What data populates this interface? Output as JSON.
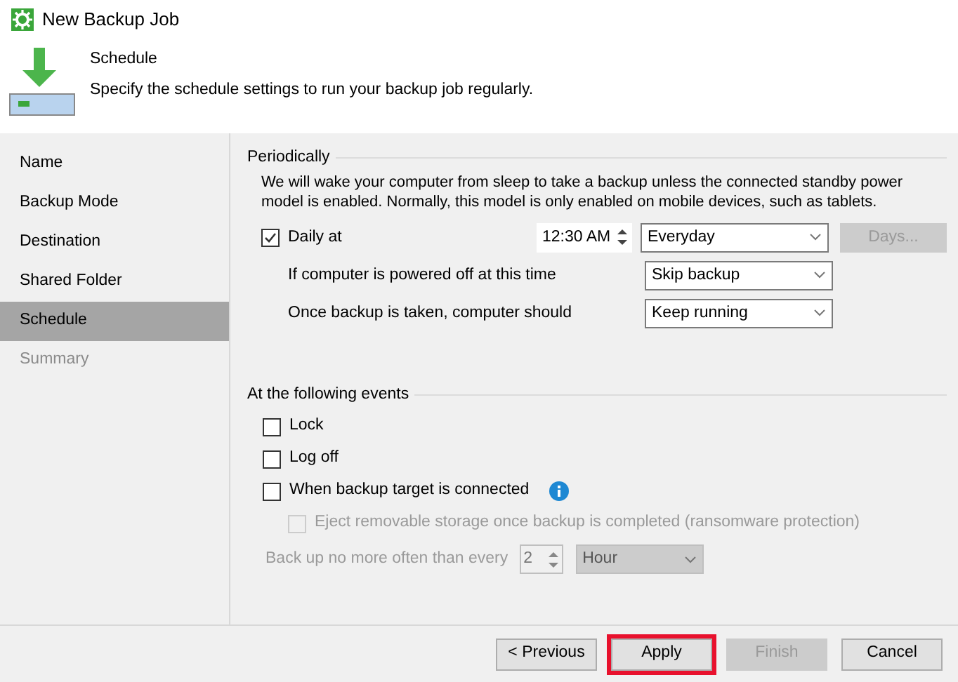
{
  "window": {
    "title": "New Backup Job"
  },
  "header": {
    "title": "Schedule",
    "description": "Specify the schedule settings to run your backup job regularly."
  },
  "steps": [
    {
      "label": "Name",
      "selected": false,
      "disabled": false
    },
    {
      "label": "Backup Mode",
      "selected": false,
      "disabled": false
    },
    {
      "label": "Destination",
      "selected": false,
      "disabled": false
    },
    {
      "label": "Shared Folder",
      "selected": false,
      "disabled": false
    },
    {
      "label": "Schedule",
      "selected": true,
      "disabled": false
    },
    {
      "label": "Summary",
      "selected": false,
      "disabled": true
    }
  ],
  "periodically": {
    "heading": "Periodically",
    "note": "We will wake your computer from sleep to take a backup unless the connected standby power model is enabled. Normally, this model is only enabled on mobile devices, such as tablets.",
    "daily": {
      "label": "Daily at",
      "checked": true
    },
    "time": "12:30 AM",
    "frequency": "Everyday",
    "days_button": {
      "label": "Days...",
      "disabled": true
    },
    "rows": [
      {
        "label": "If computer is powered off at this time",
        "value": "Skip backup"
      },
      {
        "label": "Once backup is taken, computer should",
        "value": "Keep running"
      }
    ]
  },
  "events": {
    "heading": "At the following events",
    "items": [
      {
        "label": "Lock",
        "checked": false,
        "disabled": false,
        "info": false
      },
      {
        "label": "Log off",
        "checked": false,
        "disabled": false,
        "info": false
      },
      {
        "label": "When backup target is connected",
        "checked": false,
        "disabled": false,
        "info": true,
        "children": [
          {
            "label": "Eject removable storage once backup is completed (ransomware protection)",
            "checked": false,
            "disabled": true,
            "info": false
          }
        ]
      }
    ],
    "limit": {
      "label": "Back up no more often than every",
      "count": "2",
      "unit": "Hour",
      "disabled": true
    }
  },
  "buttons": [
    {
      "label": "< Previous",
      "disabled": false,
      "highlighted": false
    },
    {
      "label": "Apply",
      "disabled": false,
      "highlighted": true
    },
    {
      "label": "Finish",
      "disabled": true,
      "highlighted": false
    },
    {
      "label": "Cancel",
      "disabled": false,
      "highlighted": false
    }
  ]
}
